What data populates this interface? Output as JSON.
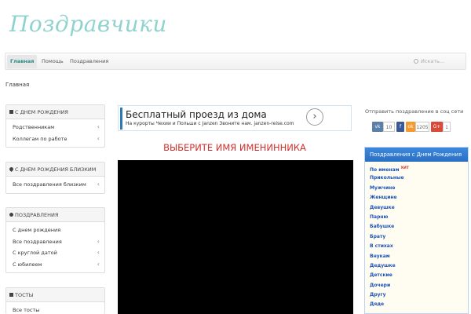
{
  "logo": "Поздравчики",
  "nav": {
    "items": [
      "Главная",
      "Помощь",
      "Поздравления"
    ],
    "search_placeholder": "Искать..."
  },
  "breadcrumb": "Главная",
  "sidebar": {
    "panel1": {
      "title": "С днем рождения",
      "items": [
        "Родственникам",
        "Коллегам по работе"
      ]
    },
    "panel2": {
      "title": "С днем рождения близким",
      "items": [
        "Все поздравления близким"
      ]
    },
    "panel3": {
      "title": "Поздравления",
      "items": [
        "С днем рождения",
        "Все поздравления",
        "С круглой датой",
        "С юбилеем"
      ]
    },
    "panel4": {
      "title": "Тосты",
      "items": [
        "Все тосты"
      ]
    }
  },
  "ad": {
    "title": "Бесплатный проезд из дома",
    "text": "На курорты Чехии и Польши с Janzen Звоните нам. janzen-reise.com",
    "arrow": "›"
  },
  "headline": "ВЫБЕРИТЕ ИМЯ ИМЕНИННИКА",
  "share": {
    "title": "Отправить поздравление в соц сети",
    "vk_label": "vk",
    "vk_count": "10",
    "fb_label": "f",
    "ok_label": "ok",
    "ok_count": "1205",
    "g_label": "G+",
    "g_count": "1",
    "colors": {
      "vk": "#5b7fa6",
      "fb": "#3b5998",
      "ok": "#f59a2e",
      "g": "#d94b38"
    }
  },
  "birthday_box": {
    "title": "Поздравления с Днем Рождения",
    "hit_badge": "ХИТ",
    "links": [
      "По именам",
      "Прикольные",
      "Мужчине",
      "Женщине",
      "Девушке",
      "Парню",
      "Бабушке",
      "Брату",
      "В стихах",
      "Внукам",
      "Дедушке",
      "Детские",
      "Дочери",
      "Другу",
      "Дяде"
    ]
  }
}
